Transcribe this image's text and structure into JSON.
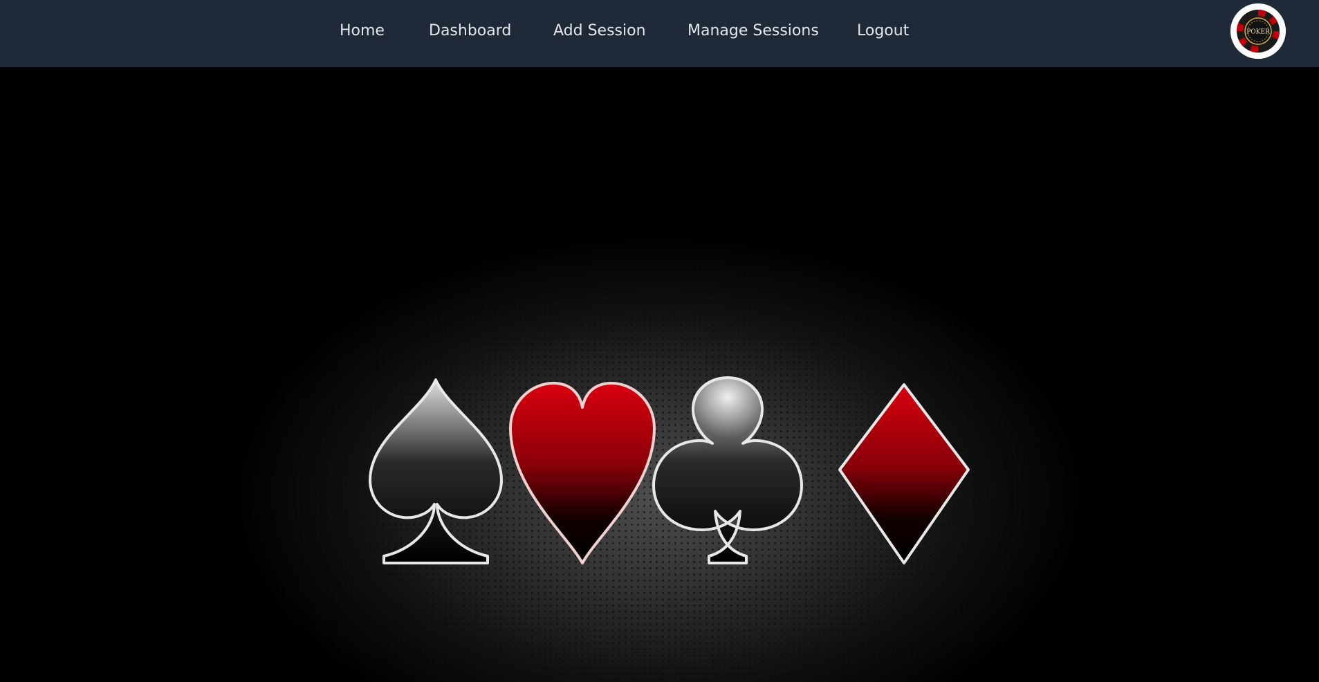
{
  "nav": {
    "links": [
      {
        "label": "Home"
      },
      {
        "label": "Dashboard"
      },
      {
        "label": "Add Session"
      },
      {
        "label": "Manage Sessions"
      },
      {
        "label": "Logout"
      }
    ],
    "logo_text": "POKER"
  },
  "hero": {
    "suit_icons": [
      "spade-icon",
      "heart-icon",
      "club-icon",
      "diamond-icon"
    ],
    "colors": {
      "navbar": "#1f2937",
      "nav_text": "#e5e7eb",
      "red": "#c0000b",
      "black": "#000000"
    }
  }
}
